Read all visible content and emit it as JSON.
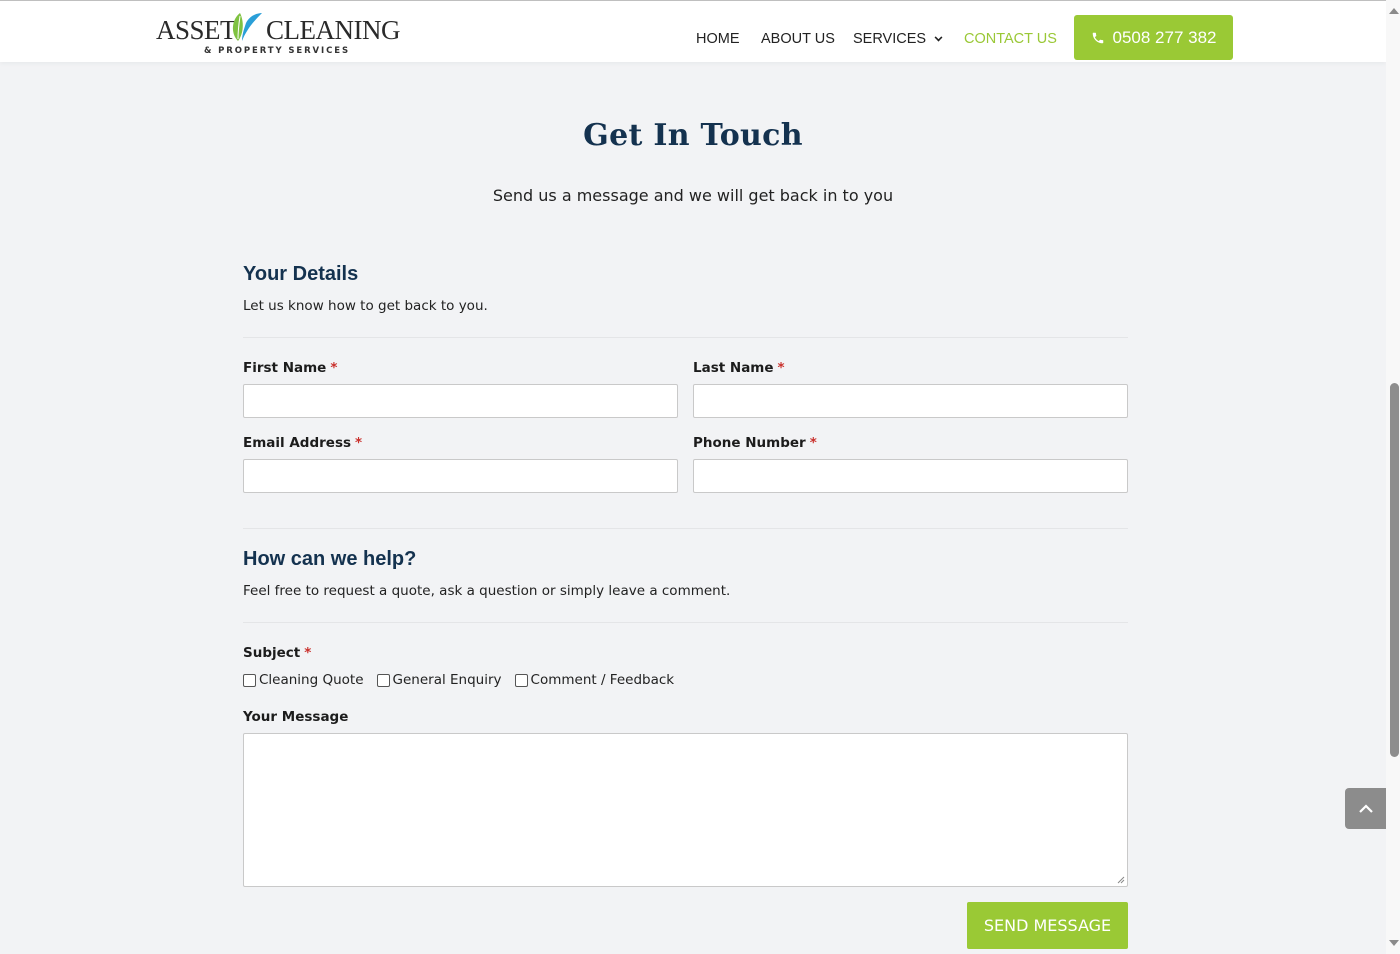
{
  "header": {
    "logo": {
      "main_left": "ASSET",
      "main_right": "CLEANING",
      "sub": "& PROPERTY SERVICES"
    },
    "nav": [
      {
        "label": "HOME",
        "active": false
      },
      {
        "label": "ABOUT US",
        "active": false
      },
      {
        "label": "SERVICES",
        "active": false,
        "has_dropdown": true
      },
      {
        "label": "CONTACT US",
        "active": true
      }
    ],
    "phone_button": {
      "icon": "phone-icon",
      "label": "0508 277 382"
    }
  },
  "colors": {
    "accent_green": "#9ac935",
    "heading_navy": "#14324f",
    "required_red": "#c9302c",
    "background": "#f2f3f5"
  },
  "page": {
    "title": "Get In Touch",
    "subtitle": "Send us a message and we will get back in to you"
  },
  "details_section": {
    "heading": "Your Details",
    "description": "Let us know how to get back to you.",
    "fields": [
      {
        "label": "First Name",
        "required": "*",
        "value": "",
        "placeholder": ""
      },
      {
        "label": "Last Name",
        "required": "*",
        "value": "",
        "placeholder": ""
      },
      {
        "label": "Email Address",
        "required": "*",
        "value": "",
        "placeholder": ""
      },
      {
        "label": "Phone Number",
        "required": "*",
        "value": "",
        "placeholder": ""
      }
    ]
  },
  "help_section": {
    "heading": "How can we help?",
    "description": "Feel free to request a quote, ask a question or simply leave a comment.",
    "subject": {
      "label": "Subject",
      "required": "*",
      "options": [
        {
          "label": "Cleaning Quote",
          "checked": false
        },
        {
          "label": "General Enquiry",
          "checked": false
        },
        {
          "label": "Comment / Feedback",
          "checked": false
        }
      ]
    },
    "message": {
      "label": "Your Message",
      "value": ""
    }
  },
  "send_button": {
    "label": "SEND MESSAGE"
  },
  "scroll_top_button": {
    "icon": "chevron-up-icon"
  }
}
